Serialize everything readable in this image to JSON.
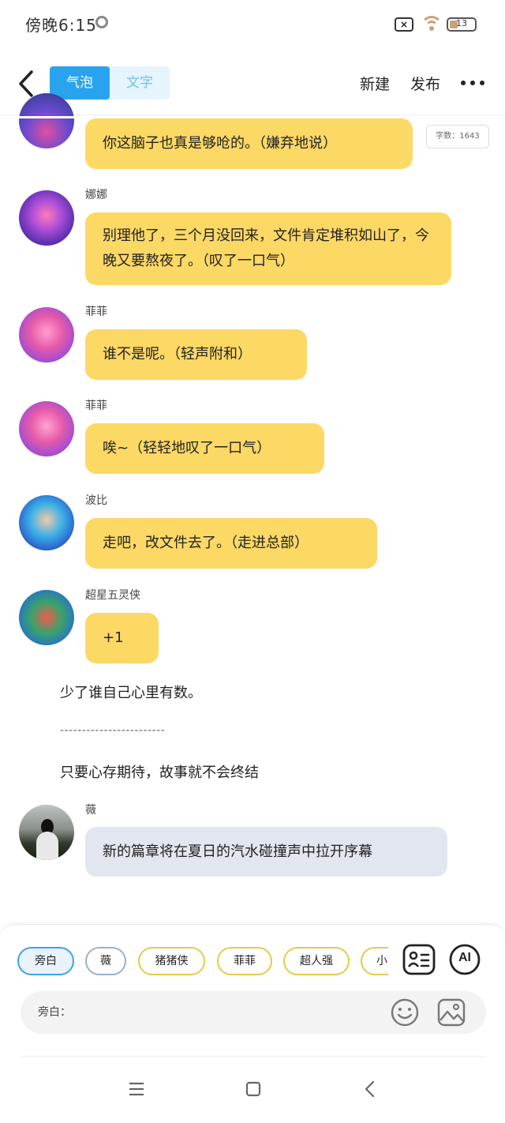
{
  "status_bar": {
    "time": "傍晚6:15",
    "battery": "13"
  },
  "top_bar": {
    "tabs": [
      {
        "label": "气泡"
      },
      {
        "label": "文字"
      }
    ],
    "new_label": "新建",
    "publish_label": "发布"
  },
  "word_count": "字数：1643",
  "messages": [
    {
      "name": "",
      "text": "你这脑子也真是够呛的。（嫌弃地说）"
    },
    {
      "name": "娜娜",
      "text": "别理他了，三个月没回来，文件肯定堆积如山了，今晚又要熬夜了。（叹了一口气）"
    },
    {
      "name": "菲菲",
      "text": "谁不是呢。（轻声附和）"
    },
    {
      "name": "菲菲",
      "text": "唉~（轻轻地叹了一口气）"
    },
    {
      "name": "波比",
      "text": "走吧，改文件去了。（走进总部）"
    },
    {
      "name": "超星五灵侠",
      "text": "+1"
    },
    {
      "name": "薇",
      "text": "新的篇章将在夏日的汽水碰撞声中拉开序幕"
    }
  ],
  "narration": {
    "line1": "少了谁自己心里有数。",
    "divider": "------------------------",
    "line2": "只要心存期待，故事就不会终结"
  },
  "composer": {
    "chips": [
      "旁白",
      "薇",
      "猪猪侠",
      "菲菲",
      "超人强",
      "小"
    ],
    "ai_label": "AI",
    "input_label": "旁白：",
    "input_value": "",
    "input_placeholder": ""
  },
  "colors": {
    "accent": "#2aa3ee",
    "bubble_yellow": "#fcd865",
    "bubble_gray": "#e2e6ee",
    "chip_gold": "#e8c849"
  }
}
